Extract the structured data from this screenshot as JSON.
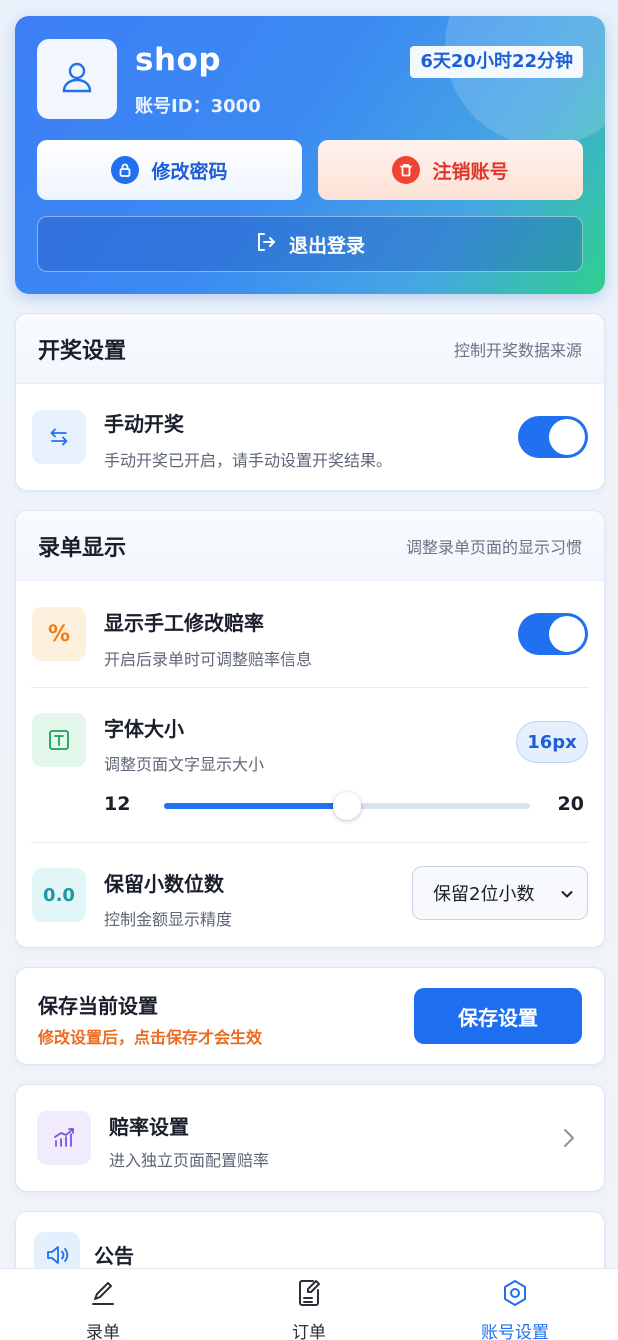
{
  "profile": {
    "username": "shop",
    "account_id": "账号ID：3000",
    "countdown": "6天20小时22分钟",
    "change_password": "修改密码",
    "deactivate": "注销账号",
    "logout": "退出登录"
  },
  "draw_settings": {
    "title": "开奖设置",
    "subtitle": "控制开奖数据来源",
    "manual_draw": {
      "title": "手动开奖",
      "desc": "手动开奖已开启，请手动设置开奖结果。",
      "enabled": true
    }
  },
  "display_settings": {
    "title": "录单显示",
    "subtitle": "调整录单页面的显示习惯",
    "manual_odds": {
      "icon_text": "%",
      "title": "显示手工修改赔率",
      "desc": "开启后录单时可调整赔率信息",
      "enabled": true
    },
    "font_size": {
      "title": "字体大小",
      "desc": "调整页面文字显示大小",
      "value_label": "16px",
      "value": 16,
      "min": 12,
      "max": 20,
      "min_label": "12",
      "max_label": "20"
    },
    "decimals": {
      "icon_text": "0.0",
      "title": "保留小数位数",
      "desc": "控制金额显示精度",
      "selected": "保留2位小数"
    }
  },
  "save": {
    "title": "保存当前设置",
    "warning": "修改设置后，点击保存才会生效",
    "button": "保存设置"
  },
  "odds_nav": {
    "title": "赔率设置",
    "desc": "进入独立页面配置赔率"
  },
  "notice": {
    "title": "公告"
  },
  "tabs": [
    {
      "label": "录单",
      "icon": "pencil-icon",
      "active": false
    },
    {
      "label": "订单",
      "icon": "order-icon",
      "active": false
    },
    {
      "label": "账号设置",
      "icon": "settings-icon",
      "active": true
    }
  ],
  "colors": {
    "primary": "#2170ef",
    "danger": "#e1362b",
    "warning": "#ee6a1d"
  }
}
